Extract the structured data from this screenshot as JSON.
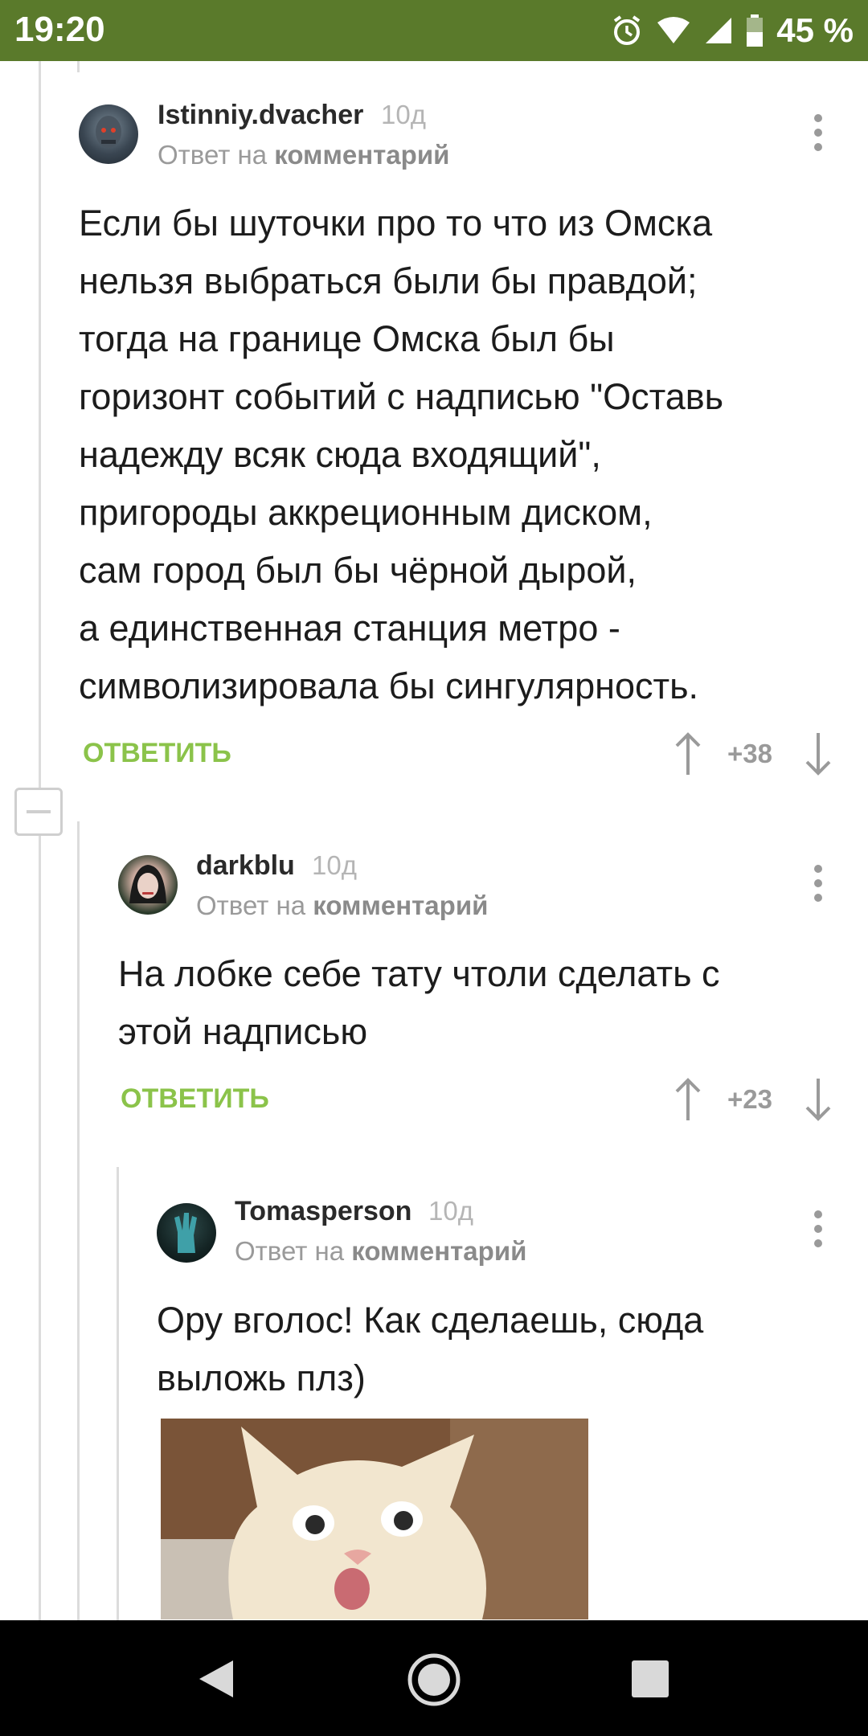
{
  "status_bar": {
    "time": "19:20",
    "battery": "45 %",
    "icons": [
      "alarm-icon",
      "wifi-icon",
      "signal-icon",
      "battery-icon"
    ]
  },
  "comments": [
    {
      "username": "Istinniy.dvacher",
      "age": "10д",
      "reply_prefix": "Ответ на",
      "reply_target": "комментарий",
      "text": "Если бы шуточки про то что из Омска\nнельзя выбраться были бы правдой;\nтогда на границе Омска был бы\nгоризонт событий с надписью \"Оставь\nнадежду всяк сюда входящий\",\nпригороды аккреционным диском,\nсам город был бы чёрной дырой,\nа единственная станция метро -\nсимволизировала бы сингулярность.",
      "reply_label": "ОТВЕТИТЬ",
      "score": "+38"
    },
    {
      "username": "darkblu",
      "age": "10д",
      "reply_prefix": "Ответ на",
      "reply_target": "комментарий",
      "text": "На лобке себе тату чтоли сделать с\nэтой надписью",
      "reply_label": "ОТВЕТИТЬ",
      "score": "+23"
    },
    {
      "username": "Tomasperson",
      "age": "10д",
      "reply_prefix": "Ответ на",
      "reply_target": "комментарий",
      "text": "Ору вголос! Как сделаешь, сюда\nвыложь плз)"
    }
  ],
  "nav": {
    "icons": [
      "back-icon",
      "home-icon",
      "recents-icon"
    ]
  },
  "colors": {
    "status_bar": "#5a7a2b",
    "reply_button": "#8bc34a",
    "muted_text": "#9a9a9a"
  }
}
